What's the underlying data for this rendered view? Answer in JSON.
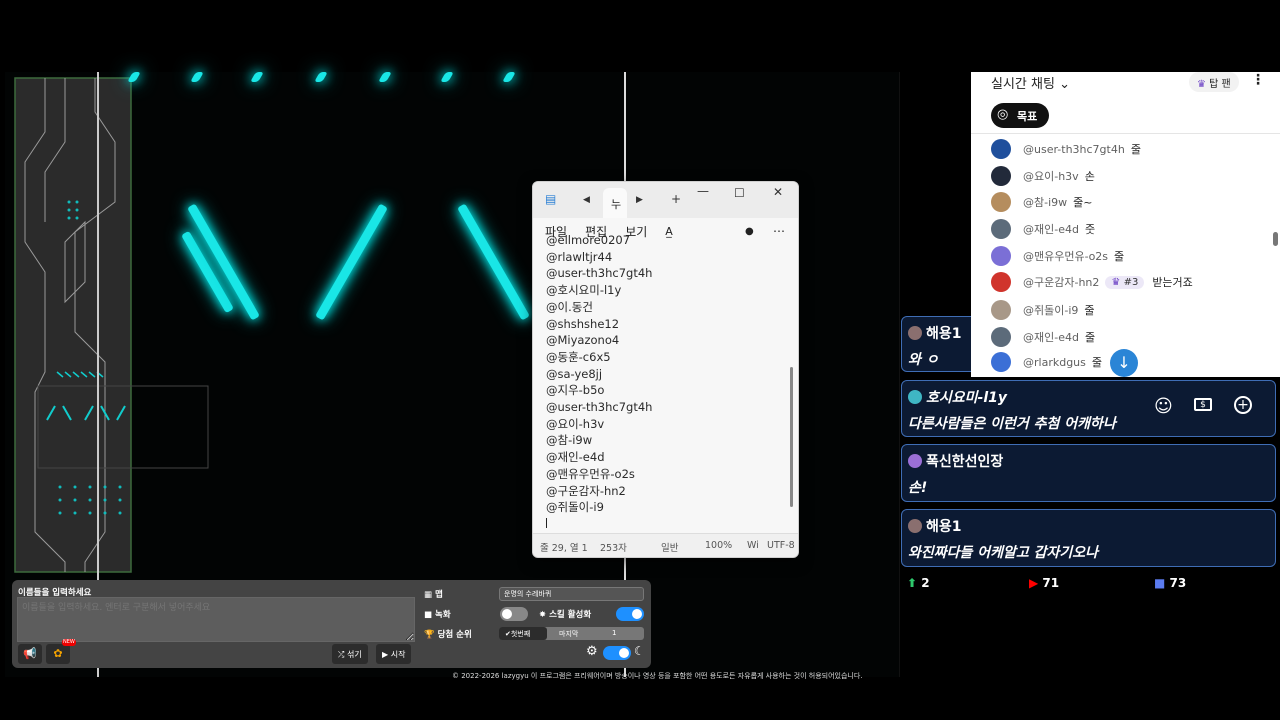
{
  "notepad": {
    "tab_label": "누",
    "menu": [
      "파일",
      "편집",
      "보기"
    ],
    "lines": [
      "@ellmore0207",
      "@rlawltjr44",
      "@user-th3hc7gt4h",
      "@호시요미-l1y",
      "@이.동건",
      "@shshshe12",
      "@Miyazono4",
      "@동훈-c6x5",
      "@sa-ye8jj",
      "@지우-b5o",
      "@user-th3hc7gt4h",
      "@요이-h3v",
      "@참-i9w",
      "@재인-e4d",
      "@맨유우먼유-o2s",
      "@구운감자-hn2",
      "@쥐돌이-i9"
    ],
    "status": {
      "position": "줄 29, 열 1",
      "chars": "253자",
      "mode": "일반",
      "zoom": "100%",
      "eol": "Wi",
      "encoding": "UTF-8"
    }
  },
  "chat": {
    "title": "실시간 채팅",
    "top_fan": "탑 팬",
    "goal": "목표",
    "rows": [
      {
        "handle": "@user-th3hc7gt4h",
        "msg": "줄",
        "color": "#1f4f9c"
      },
      {
        "handle": "@요이-h3v",
        "msg": "손",
        "color": "#222a3a"
      },
      {
        "handle": "@참-i9w",
        "msg": "줄~",
        "color": "#b58d5e"
      },
      {
        "handle": "@재인-e4d",
        "msg": "줏",
        "color": "#5c6b7a"
      },
      {
        "handle": "@맨유우먼유-o2s",
        "msg": "줄",
        "color": "#7b6fd6"
      },
      {
        "handle": "@구운감자-hn2",
        "badge": "#3",
        "msg": "받는거죠",
        "color": "#d0342c"
      },
      {
        "handle": "@쥐돌이-i9",
        "msg": "줄",
        "color": "#a89888"
      },
      {
        "handle": "@재인-e4d",
        "msg": "줄",
        "color": "#5c6b7a"
      },
      {
        "handle": "@rlarkdgus",
        "msg": "줄",
        "color": "#3b6fd6"
      }
    ]
  },
  "bubbles": [
    {
      "name": "해용1",
      "msg": "와 ㅇ",
      "dot": "#8a6f6f"
    },
    {
      "name": "호시요미-l1y",
      "msg": "다른사람들은 이런거 추첨 어캐하나",
      "dot": "#3fb6c4"
    },
    {
      "name": "폭신한선인장",
      "msg": "손!",
      "dot": "#9b6fd6"
    },
    {
      "name": "해용1",
      "msg": "와진짜다들 어케알고 갑자기오나",
      "dot": "#8a6f6f"
    }
  ],
  "stats": {
    "a": "2",
    "b": "71",
    "c": "73"
  },
  "controls": {
    "title": "이름들을 입력하세요",
    "placeholder": "이름들을 입력하세요. 엔터로 구분해서 넣어주세요",
    "map_label": "맵",
    "map_select": "운명의 수레바퀴",
    "record_label": "녹화",
    "skill_label": "스킬 활성화",
    "rank_label": "당첨 순위",
    "first": "✔첫번째",
    "last": "마지막",
    "rank_value": "1",
    "shuffle": "섞기",
    "start": "시작",
    "new_badge": "NEW"
  },
  "footer": "© 2022-2026 lazygyu 이 프로그램은 프리웨어이며 방송이나 영상 등을 포함한 어떤 용도로든 자유롭게 사용하는 것이 허용되어있습니다."
}
